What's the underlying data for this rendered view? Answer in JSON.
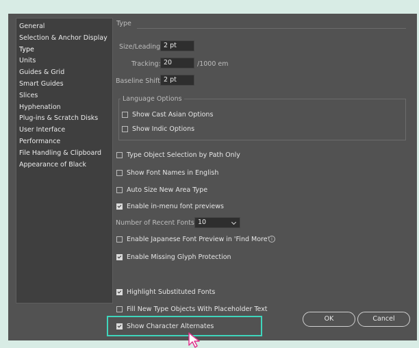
{
  "categories": [
    {
      "label": "General",
      "selected": false
    },
    {
      "label": "Selection & Anchor Display",
      "selected": false
    },
    {
      "label": "Type",
      "selected": true
    },
    {
      "label": "Units",
      "selected": false
    },
    {
      "label": "Guides & Grid",
      "selected": false
    },
    {
      "label": "Smart Guides",
      "selected": false
    },
    {
      "label": "Slices",
      "selected": false
    },
    {
      "label": "Hyphenation",
      "selected": false
    },
    {
      "label": "Plug-ins & Scratch Disks",
      "selected": false
    },
    {
      "label": "User Interface",
      "selected": false
    },
    {
      "label": "Performance",
      "selected": false
    },
    {
      "label": "File Handling & Clipboard",
      "selected": false
    },
    {
      "label": "Appearance of Black",
      "selected": false
    }
  ],
  "type_panel": {
    "title": "Type",
    "size_leading": {
      "label": "Size/Leading:",
      "value": "2 pt"
    },
    "tracking": {
      "label": "Tracking:",
      "value": "20",
      "unit": "/1000 em"
    },
    "baseline_shift": {
      "label": "Baseline Shift:",
      "value": "2 pt"
    },
    "language_options": {
      "title": "Language Options",
      "show_east_asian": {
        "label": "Show Cast Asian Options",
        "checked": false
      },
      "show_indic": {
        "label": "Show Indic Options",
        "checked": false
      }
    },
    "type_object_selection": {
      "label": "Type Object Selection by Path Only",
      "checked": false
    },
    "font_names_english": {
      "label": "Show Font Names in English",
      "checked": false
    },
    "auto_size_area": {
      "label": "Auto Size New Area Type",
      "checked": false
    },
    "in_menu_previews": {
      "label": "Enable in-menu font previews",
      "checked": true
    },
    "recent_fonts": {
      "label": "Number of Recent Fonts:",
      "value": "10"
    },
    "japanese_preview": {
      "label": "Enable Japanese Font Preview in 'Find More'",
      "checked": false
    },
    "missing_glyph": {
      "label": "Enable Missing Glyph Protection",
      "checked": true
    },
    "highlight_substituted": {
      "label": "Highlight Substituted Fonts",
      "checked": true
    },
    "fill_placeholder": {
      "label": "Fill New Type Objects With Placeholder Text",
      "checked": false
    },
    "show_char_alternates": {
      "label": "Show Character Alternates",
      "checked": true
    }
  },
  "buttons": {
    "ok": "OK",
    "cancel": "Cancel"
  },
  "info_icon": "info-icon",
  "colors": {
    "highlight": "#3fd6bd",
    "selection": "#3a70c4",
    "cursor": "#e0338e"
  }
}
